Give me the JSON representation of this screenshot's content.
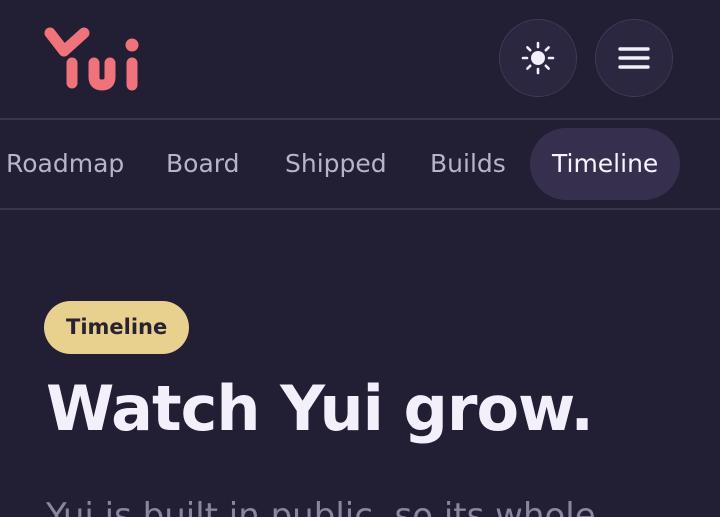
{
  "app": {
    "logo_text": "Yui",
    "brand_color": "#f0727a"
  },
  "header": {
    "theme_icon": "sun-icon",
    "menu_icon": "hamburger-menu-icon"
  },
  "nav": {
    "tabs": [
      {
        "label": "Roadmap",
        "active": false
      },
      {
        "label": "Board",
        "active": false
      },
      {
        "label": "Shipped",
        "active": false
      },
      {
        "label": "Builds",
        "active": false
      },
      {
        "label": "Timeline",
        "active": true
      }
    ]
  },
  "hero": {
    "badge": "Timeline",
    "title": "Watch Yui grow.",
    "description": "Yui is built in public, so its whole"
  },
  "colors": {
    "background": "#221e33",
    "badge_bg": "#e8d08f",
    "active_tab_bg": "#36304e"
  }
}
